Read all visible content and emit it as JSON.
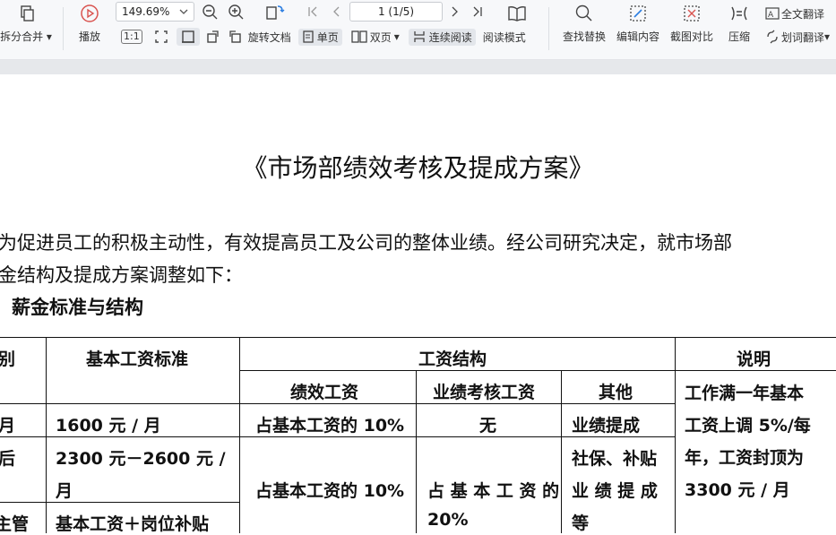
{
  "toolbar": {
    "split_merge": "拆分合并",
    "play": "播放",
    "zoom_value": "149.69%",
    "page_indicator": "1 (1/5)",
    "rotate": "旋转文档",
    "single_page": "单页",
    "double_page": "双页",
    "continuous": "连续阅读",
    "read_mode": "阅读模式",
    "find_replace": "查找替换",
    "edit_content": "编辑内容",
    "screenshot_compare": "截图对比",
    "compress": "压缩",
    "full_translate": "全文翻译",
    "word_translate": "划词翻译",
    "one_to_one": "1:1"
  },
  "document": {
    "title": "《市场部绩效考核及提成方案》",
    "para_line1": "为促进员工的积极主动性，有效提高员工及公司的整体业绩。经公司研究决定，就市场部",
    "para_line2": "金结构及提成方案调整如下：",
    "section1": "、薪金标准与结构",
    "table": {
      "h_col1": "别",
      "h_base": "基本工资标准",
      "h_structure": "工资结构",
      "h_note": "说明",
      "h_perf": "绩效工资",
      "h_assess": "业绩考核工资",
      "h_other": "其他",
      "r1_col1": "月",
      "r1_base": "1600 元 / 月",
      "r1_perf": "占基本工资的 10%",
      "r1_assess": "无",
      "r1_other": "业绩提成",
      "r2_col1": "后",
      "r2_base_l1": "2300  元－2600  元 /",
      "r2_base_l2": "月",
      "r2_perf": "占基本工资的 10%",
      "r2_assess_l1": "占 基 本 工 资 的",
      "r2_assess_l2": "20%",
      "r2_other_l1": "社保、补贴",
      "r2_other_l2": "业 绩 提 成",
      "r2_other_l3": "等",
      "r3_col1": "主管",
      "r3_base": "基本工资＋岗位补贴",
      "note_l1": "工作满一年基本",
      "note_l2": "工资上调 5%/每",
      "note_l3": "年，工资封顶为",
      "note_l4": "3300 元 / 月"
    }
  }
}
